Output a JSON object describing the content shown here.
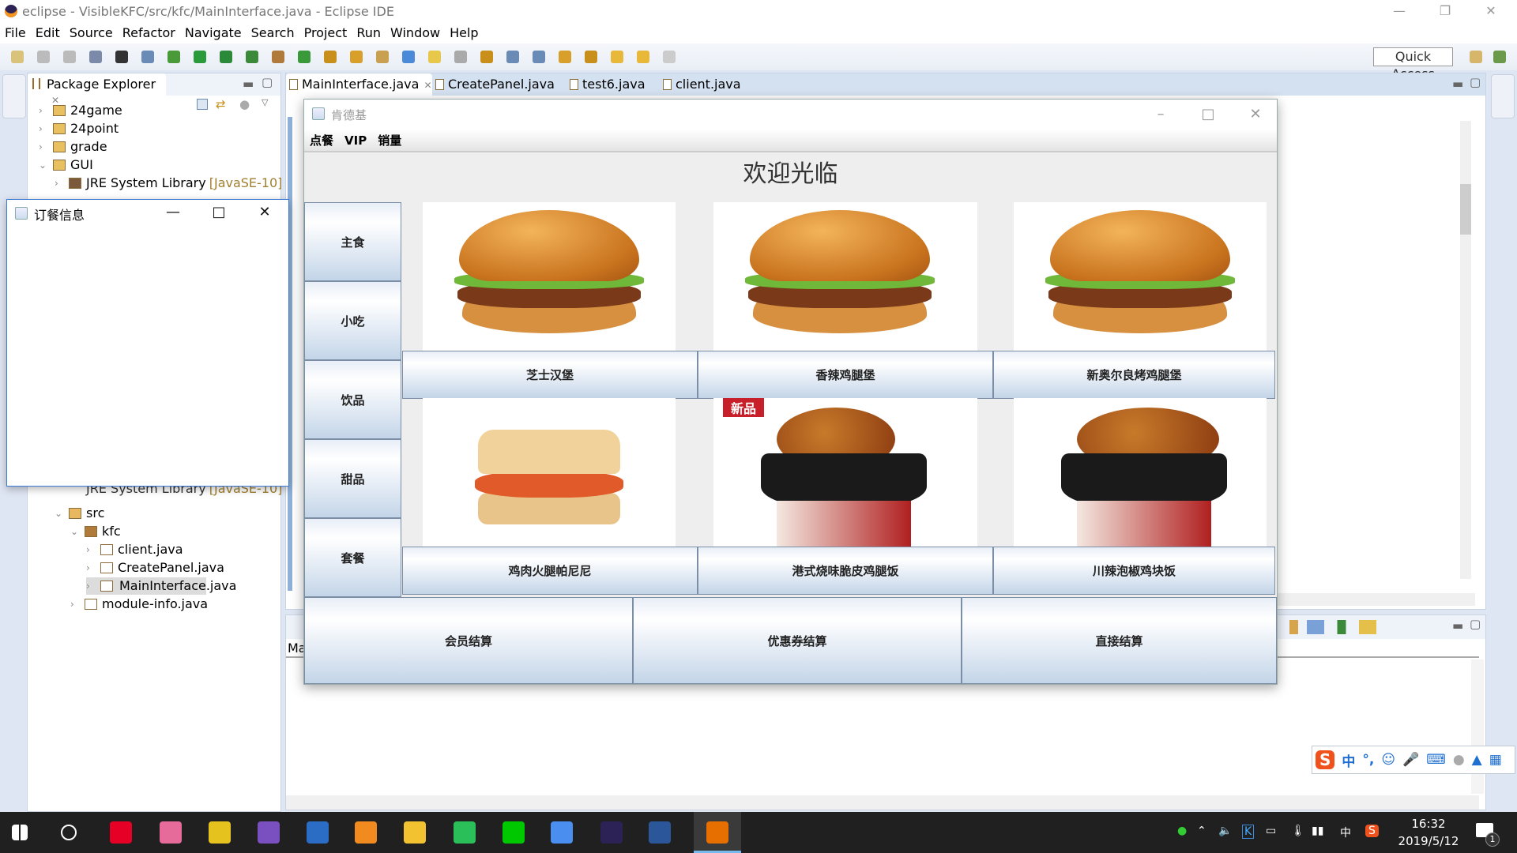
{
  "window": {
    "title": "eclipse - VisibleKFC/src/kfc/MainInterface.java - Eclipse IDE"
  },
  "menubar": [
    "File",
    "Edit",
    "Source",
    "Refactor",
    "Navigate",
    "Search",
    "Project",
    "Run",
    "Window",
    "Help"
  ],
  "toolbar": {
    "quick_access": "Quick Access"
  },
  "package_explorer": {
    "title": "Package Explorer",
    "tree": [
      {
        "label": "24game",
        "level": 0,
        "expanded": false,
        "icon": "project-icon"
      },
      {
        "label": "24point",
        "level": 0,
        "expanded": false,
        "icon": "project-icon"
      },
      {
        "label": "grade",
        "level": 0,
        "expanded": false,
        "icon": "project-icon"
      },
      {
        "label": "GUI",
        "level": 0,
        "expanded": true,
        "icon": "project-icon"
      },
      {
        "label": "JRE System Library",
        "suffix": "[JavaSE-10]",
        "level": 1,
        "expanded": false,
        "icon": "library-icon"
      },
      {
        "label": "JRE System Library",
        "suffix": "[JavaSE-10]",
        "level": 1,
        "expanded": false,
        "icon": "library-icon"
      },
      {
        "label": "src",
        "level": 1,
        "expanded": true,
        "icon": "source-folder-icon"
      },
      {
        "label": "kfc",
        "level": 2,
        "expanded": true,
        "icon": "package-icon"
      },
      {
        "label": "client.java",
        "level": 3,
        "expanded": false,
        "icon": "java-file-icon"
      },
      {
        "label": "CreatePanel.java",
        "level": 3,
        "expanded": false,
        "icon": "java-file-icon"
      },
      {
        "label": "MainInterface.java",
        "level": 3,
        "expanded": false,
        "icon": "java-file-icon",
        "selected": true
      },
      {
        "label": "module-info.java",
        "level": 2,
        "expanded": false,
        "icon": "java-file-icon"
      }
    ]
  },
  "editor": {
    "tabs": [
      {
        "label": "MainInterface.java",
        "active": true
      },
      {
        "label": "CreatePanel.java"
      },
      {
        "label": "test6.java"
      },
      {
        "label": "client.java"
      }
    ]
  },
  "bottom_panel": {
    "partial_label": "Ma"
  },
  "kfc_window": {
    "title": "肯德基",
    "menu": [
      "点餐",
      "VIP",
      "销量"
    ],
    "welcome": "欢迎光临",
    "categories": [
      "主食",
      "小吃",
      "饮品",
      "甜品",
      "套餐"
    ],
    "foods": [
      {
        "name": "芝士汉堡",
        "kind": "burger"
      },
      {
        "name": "香辣鸡腿堡",
        "kind": "burger"
      },
      {
        "name": "新奥尔良烤鸡腿堡",
        "kind": "burger"
      },
      {
        "name": "鸡肉火腿帕尼尼",
        "kind": "panini"
      },
      {
        "name": "港式烧味脆皮鸡腿饭",
        "kind": "rice",
        "badge": "新品"
      },
      {
        "name": "川辣泡椒鸡块饭",
        "kind": "rice"
      }
    ],
    "checkout": [
      "会员结算",
      "优惠券结算",
      "直接结算"
    ]
  },
  "order_window": {
    "title": "订餐信息"
  },
  "taskbar": {
    "apps": [
      {
        "icon": "start-icon",
        "color": "#ffffff"
      },
      {
        "icon": "search-icon",
        "color": "#ffffff"
      },
      {
        "icon": "netease-music-icon",
        "color": "#e60026"
      },
      {
        "icon": "bilibili-icon",
        "color": "#e66b9a"
      },
      {
        "icon": "browser-icon",
        "color": "#e6c21e"
      },
      {
        "icon": "visual-studio-icon",
        "color": "#7a4fbf"
      },
      {
        "icon": "vs-code-icon",
        "color": "#2b6cc4"
      },
      {
        "icon": "orange-app-icon",
        "color": "#f28b1f"
      },
      {
        "icon": "file-explorer-icon",
        "color": "#f2c230"
      },
      {
        "icon": "media-player-icon",
        "color": "#2bbf5a"
      },
      {
        "icon": "iqiyi-icon",
        "color": "#00c800"
      },
      {
        "icon": "feather-app-icon",
        "color": "#4a8ff0"
      },
      {
        "icon": "eclipse-icon",
        "color": "#2c2255"
      },
      {
        "icon": "word-icon",
        "color": "#2b579a"
      },
      {
        "icon": "java-icon",
        "color": "#e76f00",
        "active": true
      }
    ],
    "ime": "中",
    "time": "16:32",
    "date": "2019/5/12",
    "notifications": "1"
  },
  "ime_bar": {
    "mode": "中",
    "punct": "°,"
  }
}
